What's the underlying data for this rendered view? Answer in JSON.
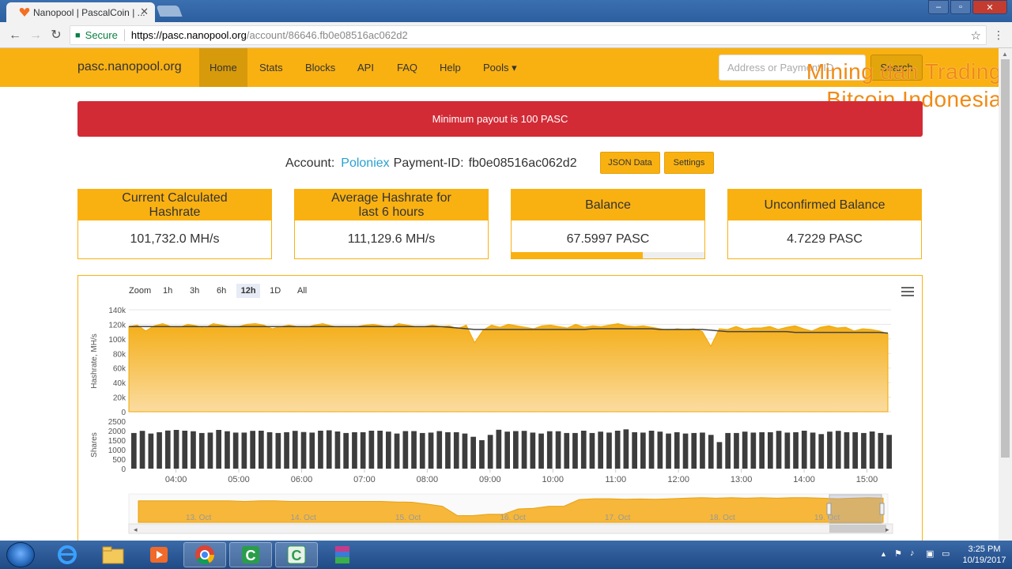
{
  "browser": {
    "tab_title": "Nanopool | PascalCoin | ...",
    "url_secure_label": "Secure",
    "url_host": "https://pasc.nanopool.org",
    "url_path": "/account/86646.fb0e08516ac062d2"
  },
  "nav": {
    "brand": "pasc.nanopool.org",
    "items": [
      {
        "label": "Home",
        "active": true
      },
      {
        "label": "Stats"
      },
      {
        "label": "Blocks"
      },
      {
        "label": "API"
      },
      {
        "label": "FAQ"
      },
      {
        "label": "Help"
      },
      {
        "label": "Pools ▾"
      }
    ],
    "search_placeholder": "Address or Payment ID",
    "search_button": "Search"
  },
  "watermark": {
    "line1": "Mining dan Trading",
    "line2": "Bitcoin Indonesia"
  },
  "alert": "Minimum payout is 100 PASC",
  "account": {
    "label": "Account:",
    "name": "Poloniex",
    "payment_label": "Payment-ID:",
    "payment_id": "fb0e08516ac062d2",
    "json_button": "JSON Data",
    "settings_button": "Settings"
  },
  "cards": [
    {
      "title": "Current Calculated Hashrate",
      "value": "101,732.0 MH/s"
    },
    {
      "title": "Average Hashrate for last 6 hours",
      "value": "111,129.6 MH/s"
    },
    {
      "title": "Balance",
      "value": "67.5997 PASC",
      "progress": 0.68
    },
    {
      "title": "Unconfirmed Balance",
      "value": "4.7229 PASC"
    }
  ],
  "chart": {
    "zoom_label": "Zoom",
    "zoom_buttons": [
      "1h",
      "3h",
      "6h",
      "12h",
      "1D",
      "All"
    ],
    "zoom_selected": "12h"
  },
  "chart_data": [
    {
      "type": "area",
      "ylabel": "Hashrate, MH/s",
      "ylim": [
        0,
        140000
      ],
      "y_ticks": [
        "0",
        "20k",
        "40k",
        "60k",
        "80k",
        "100k",
        "120k",
        "140k"
      ],
      "x_ticks": [
        "04:00",
        "05:00",
        "06:00",
        "07:00",
        "08:00",
        "09:00",
        "10:00",
        "11:00",
        "12:00",
        "13:00",
        "14:00",
        "15:00"
      ],
      "x_range": [
        "03:15",
        "15:20"
      ],
      "series": [
        {
          "values": [
            117000,
            119000,
            111000,
            118000,
            121000,
            117000,
            116000,
            120000,
            118000,
            115000,
            121000,
            119000,
            117000,
            117000,
            120000,
            121000,
            119000,
            114000,
            117000,
            119000,
            117000,
            116000,
            119000,
            121000,
            118000,
            116000,
            117000,
            117000,
            119000,
            120000,
            118000,
            116000,
            121000,
            119000,
            117000,
            117000,
            119000,
            117000,
            118000,
            114000,
            119000,
            95000,
            112000,
            119000,
            116000,
            120000,
            118000,
            116000,
            114000,
            118000,
            119000,
            117000,
            115000,
            120000,
            116000,
            118000,
            117000,
            119000,
            121000,
            118000,
            117000,
            118000,
            116000,
            114000,
            112000,
            114000,
            113000,
            114000,
            110000,
            90000,
            114000,
            113000,
            117000,
            113000,
            115000,
            115000,
            117000,
            113000,
            116000,
            118000,
            114000,
            111000,
            116000,
            118000,
            115000,
            116000,
            111000,
            114000,
            113000,
            111000,
            107000
          ]
        },
        {
          "values": [
            117000,
            117000,
            117000,
            117000,
            117000,
            117000,
            117000,
            117000,
            117000,
            117000,
            117000,
            117000,
            117000,
            117000,
            117000,
            117000,
            117000,
            117000,
            117000,
            117000,
            117000,
            117000,
            117000,
            117000,
            117000,
            117000,
            117000,
            117000,
            117000,
            117000,
            117000,
            117000,
            117000,
            117000,
            117000,
            117000,
            117000,
            117000,
            116000,
            115000,
            114000,
            113000,
            113000,
            113000,
            113000,
            113000,
            113000,
            113000,
            113000,
            113000,
            113000,
            113000,
            113000,
            113000,
            113000,
            114000,
            114000,
            114000,
            114000,
            114000,
            114000,
            114000,
            114000,
            113000,
            113000,
            113000,
            113000,
            113000,
            113000,
            112000,
            111000,
            110000,
            110000,
            110000,
            110000,
            110000,
            110000,
            110000,
            110000,
            109000,
            109000,
            109000,
            109000,
            109000,
            109000,
            109000,
            109000,
            109000,
            109000,
            109000,
            108000
          ]
        }
      ]
    },
    {
      "type": "bar",
      "ylabel": "Shares",
      "ylim": [
        0,
        2500
      ],
      "y_ticks": [
        "0",
        "500",
        "1000",
        "1500",
        "2000",
        "2500"
      ],
      "values": [
        1880,
        1990,
        1850,
        1920,
        2010,
        2040,
        2000,
        1970,
        1880,
        1900,
        2040,
        1970,
        1900,
        1900,
        1990,
        2000,
        1920,
        1880,
        1920,
        1990,
        1930,
        1900,
        2000,
        2020,
        1960,
        1880,
        1920,
        1920,
        2000,
        2000,
        1950,
        1850,
        1980,
        1980,
        1880,
        1900,
        1980,
        1920,
        1920,
        1850,
        1680,
        1500,
        1780,
        2050,
        1950,
        1980,
        1990,
        1900,
        1850,
        1970,
        1970,
        1880,
        1880,
        2000,
        1880,
        1950,
        1900,
        2000,
        2070,
        1920,
        1900,
        2000,
        1950,
        1850,
        1920,
        1850,
        1880,
        1900,
        1780,
        1400,
        1880,
        1880,
        1950,
        1900,
        1920,
        1920,
        1990,
        1900,
        1920,
        2000,
        1900,
        1820,
        1950,
        1990,
        1920,
        1920,
        1880,
        1960,
        1880,
        1780
      ]
    },
    {
      "type": "area",
      "name": "navigator",
      "x_ticks": [
        "13. Oct",
        "14. Oct",
        "15. Oct",
        "16. Oct",
        "17. Oct",
        "18. Oct",
        "19. Oct"
      ]
    }
  ],
  "taskbar": {
    "time": "3:25 PM",
    "date": "10/19/2017"
  }
}
